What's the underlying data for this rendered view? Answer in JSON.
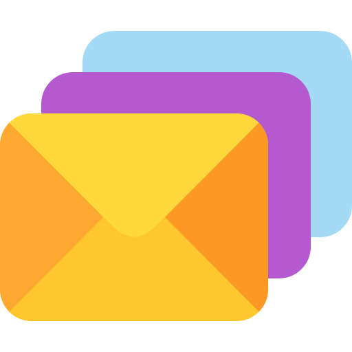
{
  "icon": {
    "name": "stacked-mail-icon",
    "colors": {
      "back_card": "#A4DAF5",
      "middle_card": "#B459D0",
      "envelope_left_flap": "#FDA830",
      "envelope_right_flap": "#FC9823",
      "envelope_bottom_flap": "#FFC72D",
      "envelope_top_flap": "#FFD83B"
    }
  }
}
